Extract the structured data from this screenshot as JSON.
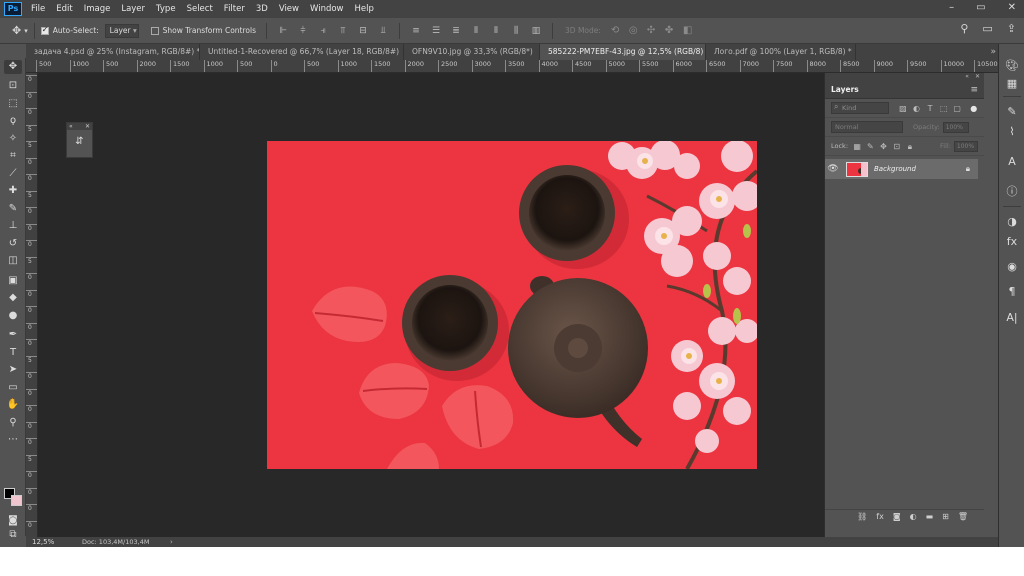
{
  "app": {
    "logo_text": "Ps"
  },
  "menu": [
    "File",
    "Edit",
    "Image",
    "Layer",
    "Type",
    "Select",
    "Filter",
    "3D",
    "View",
    "Window",
    "Help"
  ],
  "window_controls": {
    "minimize": "–",
    "restore": "▭",
    "close": "✕"
  },
  "options_bar": {
    "auto_select_label": "Auto-Select:",
    "auto_select_checked": true,
    "layer_select_value": "Layer",
    "show_transform_label": "Show Transform Controls",
    "show_transform_checked": false,
    "mode_3d_label": "3D Mode:"
  },
  "tabs": [
    {
      "label": "задача 4.psd @ 25% (Instagram, RGB/8#) *",
      "active": false
    },
    {
      "label": "Untitled-1-Recovered @ 66,7% (Layer 18, RGB/8#)",
      "active": false
    },
    {
      "label": "OFN9V10.jpg @ 33,3% (RGB/8*)",
      "active": false
    },
    {
      "label": "585222-PM7EBF-43.jpg @ 12,5% (RGB/8)",
      "active": true
    },
    {
      "label": "Лого.pdf @ 100% (Layer 1, RGB/8) *",
      "active": false
    }
  ],
  "tab_close_glyph": "×",
  "tab_overflow_glyph": "»",
  "ruler_h": [
    "500",
    "1000",
    "500",
    "2000",
    "1500",
    "1000",
    "500",
    "0",
    "500",
    "1000",
    "1500",
    "2000",
    "2500",
    "3000",
    "3500",
    "4000",
    "4500",
    "5000",
    "5500",
    "6000",
    "6500",
    "7000",
    "7500",
    "8000",
    "8500",
    "9000",
    "9500",
    "10000",
    "10500"
  ],
  "ruler_v": [
    "0",
    "0",
    "0",
    "5",
    "5",
    "0",
    "0",
    "5",
    "0",
    "0",
    "0",
    "5",
    "0",
    "0",
    "0",
    "0",
    "0",
    "5",
    "0",
    "0",
    "0",
    "0",
    "0",
    "5",
    "0",
    "0",
    "0",
    "0"
  ],
  "tools": [
    {
      "name": "move-tool-icon",
      "glyph": "✥",
      "active": true
    },
    {
      "name": "artboard-tool-icon",
      "glyph": "⊡"
    },
    {
      "name": "marquee-tool-icon",
      "glyph": "⬚"
    },
    {
      "name": "lasso-tool-icon",
      "glyph": "ϙ"
    },
    {
      "name": "magic-wand-tool-icon",
      "glyph": "✧"
    },
    {
      "name": "crop-tool-icon",
      "glyph": "⌗"
    },
    {
      "name": "eyedropper-tool-icon",
      "glyph": "⟋"
    },
    {
      "name": "spot-healing-tool-icon",
      "glyph": "✚"
    },
    {
      "name": "brush-tool-icon",
      "glyph": "✎"
    },
    {
      "name": "clone-stamp-tool-icon",
      "glyph": "⊥"
    },
    {
      "name": "history-brush-tool-icon",
      "glyph": "↺"
    },
    {
      "name": "eraser-tool-icon",
      "glyph": "◫"
    },
    {
      "name": "gradient-tool-icon",
      "glyph": "▣"
    },
    {
      "name": "blur-tool-icon",
      "glyph": "◆"
    },
    {
      "name": "dodge-tool-icon",
      "glyph": "●"
    },
    {
      "name": "pen-tool-icon",
      "glyph": "✒"
    },
    {
      "name": "type-tool-icon",
      "glyph": "T"
    },
    {
      "name": "path-selection-tool-icon",
      "glyph": "➤"
    },
    {
      "name": "shape-tool-icon",
      "glyph": "▭"
    },
    {
      "name": "hand-tool-icon",
      "glyph": "✋"
    },
    {
      "name": "zoom-tool-icon",
      "glyph": "⚲"
    },
    {
      "name": "more-tools-icon",
      "glyph": "⋯"
    }
  ],
  "colors": {
    "foreground": "#000000",
    "background": "#f0c5cd",
    "canvas_bg": "#282828",
    "image_red": "#ec3540"
  },
  "mini_panel": {
    "glyph": "⇵"
  },
  "layers_panel": {
    "tab_label": "Layers",
    "menu_glyph": "≡",
    "search_placeholder": "Kind",
    "blend_mode": "Normal",
    "opacity_label": "Opacity:",
    "opacity_value": "100%",
    "lock_label": "Lock:",
    "fill_label": "Fill:",
    "fill_value": "100%",
    "layer_name": "Background",
    "layer_visible": true
  },
  "status": {
    "zoom": "12,5%",
    "doc": "Doc: 103,4M/103,4M",
    "arrow": "›"
  }
}
